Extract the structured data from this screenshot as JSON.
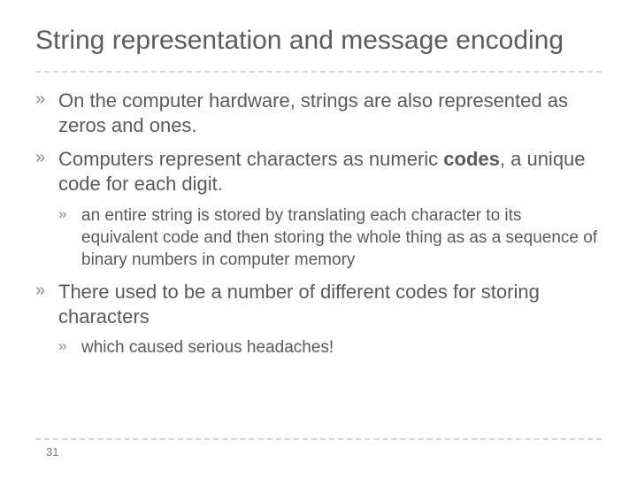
{
  "title": "String representation and message encoding",
  "bullets": {
    "b1": "On the computer hardware, strings are also represented as zeros and ones.",
    "b2a": "Computers represent characters as numeric ",
    "b2b": "codes",
    "b2c": ", a unique code for each digit.",
    "b2_sub1": "an entire string is stored by translating each character to its equivalent code and then storing the whole thing as as a sequence of binary numbers in computer memory",
    "b3": "There used to be a number of different codes for storing characters",
    "b3_sub1": "which caused serious headaches!"
  },
  "page_number": "31"
}
